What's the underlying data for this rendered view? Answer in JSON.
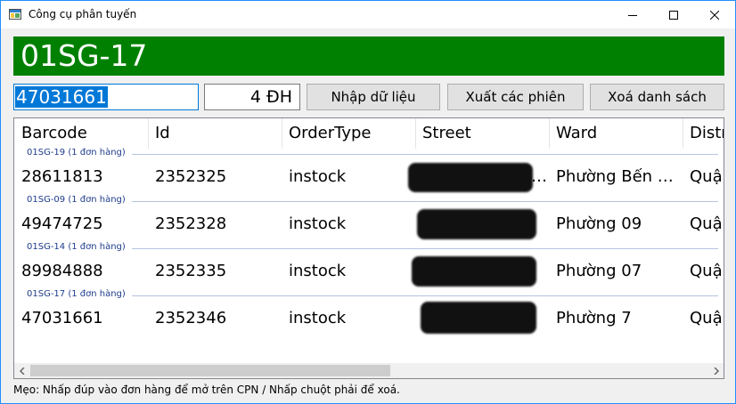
{
  "window": {
    "title": "Công cụ phân tuyến"
  },
  "banner": {
    "route": "01SG-17",
    "color": "#008000"
  },
  "inputs": {
    "barcode_value": "47031661",
    "count_value": "4 ĐH"
  },
  "buttons": {
    "import_label": "Nhập dữ liệu",
    "export_label": "Xuất các phiên",
    "clear_label": "Xoá danh sách"
  },
  "table": {
    "columns": [
      "Barcode",
      "Id",
      "OrderType",
      "Street",
      "Ward",
      "Distri"
    ],
    "groups": [
      {
        "label": "01SG-19 (1 đơn hàng)",
        "row": {
          "barcode": "28611813",
          "id": "2352325",
          "order_type": "instock",
          "street": "…",
          "ward": "Phường Bến …",
          "district": "Quận"
        }
      },
      {
        "label": "01SG-09 (1 đơn hàng)",
        "row": {
          "barcode": "49474725",
          "id": "2352328",
          "order_type": "instock",
          "street": "",
          "ward": "Phường 09",
          "district": "Quận"
        }
      },
      {
        "label": "01SG-14 (1 đơn hàng)",
        "row": {
          "barcode": "89984888",
          "id": "2352335",
          "order_type": "instock",
          "street": "",
          "ward": "Phường 07",
          "district": "Quận"
        }
      },
      {
        "label": "01SG-17 (1 đơn hàng)",
        "row": {
          "barcode": "47031661",
          "id": "2352346",
          "order_type": "instock",
          "street": "",
          "ward": "Phường 7",
          "district": "Quận"
        }
      }
    ]
  },
  "status": {
    "tip": "Mẹo: Nhấp đúp vào đơn hàng để mở trên CPN / Nhấp chuột phải để xoá."
  }
}
